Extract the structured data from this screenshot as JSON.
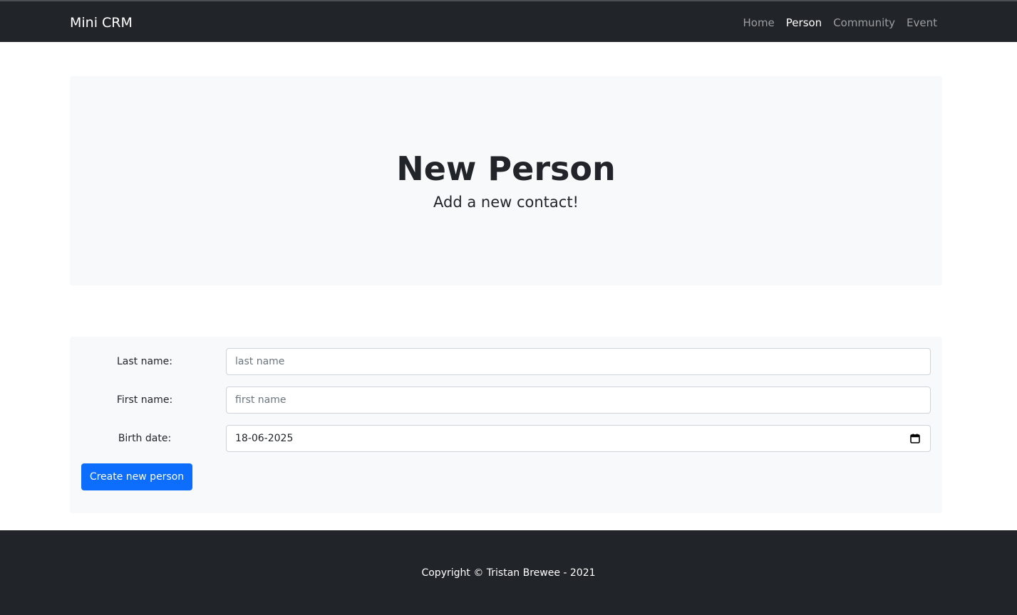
{
  "navbar": {
    "brand": "Mini CRM",
    "links": [
      {
        "label": "Home",
        "active": false
      },
      {
        "label": "Person",
        "active": true
      },
      {
        "label": "Community",
        "active": false
      },
      {
        "label": "Event",
        "active": false
      }
    ]
  },
  "hero": {
    "title": "New Person",
    "subtitle": "Add a new contact!"
  },
  "form": {
    "last_name": {
      "label": "Last name:",
      "placeholder": "last name",
      "value": ""
    },
    "first_name": {
      "label": "First name:",
      "placeholder": "first name",
      "value": ""
    },
    "birth_date": {
      "label": "Birth date:",
      "value": "18-06-2025",
      "icon": "calendar-icon"
    },
    "submit_label": "Create new person"
  },
  "footer": {
    "text": "Copyright © Tristan Brewee - 2021"
  },
  "colors": {
    "navbar_bg": "#212529",
    "panel_bg": "#f8f9fa",
    "primary": "#0d6efd"
  }
}
